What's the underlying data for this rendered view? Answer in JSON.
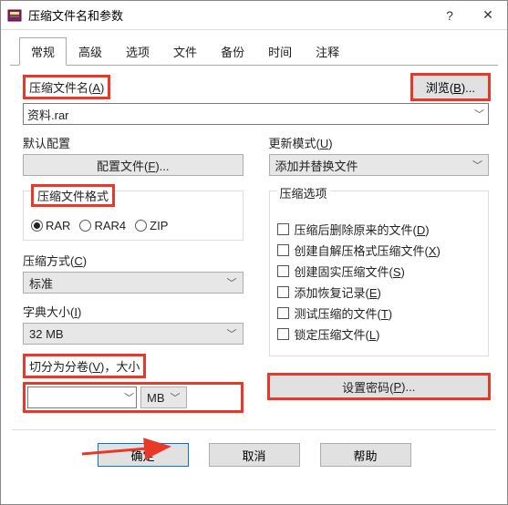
{
  "window": {
    "title": "压缩文件名和参数"
  },
  "tabs": {
    "items": [
      {
        "label": "常规"
      },
      {
        "label": "高级"
      },
      {
        "label": "选项"
      },
      {
        "label": "文件"
      },
      {
        "label": "备份"
      },
      {
        "label": "时间"
      },
      {
        "label": "注释"
      }
    ],
    "active_index": 0
  },
  "archive_name": {
    "label": "压缩文件名(",
    "accel": "A",
    "label_close": ")",
    "value": "资料.rar",
    "browse": "浏览(",
    "browse_accel": "B",
    "browse_close": ")..."
  },
  "default_profile": {
    "label": "默认配置",
    "button": "配置文件(",
    "accel": "F",
    "close": ")..."
  },
  "update_mode": {
    "label": "更新模式(",
    "accel": "U",
    "close": ")",
    "value": "添加并替换文件"
  },
  "format": {
    "label": "压缩文件格式",
    "options": [
      {
        "label": "RAR",
        "selected": true
      },
      {
        "label": "RAR4",
        "selected": false
      },
      {
        "label": "ZIP",
        "selected": false
      }
    ]
  },
  "method": {
    "label": "压缩方式(",
    "accel": "C",
    "close": ")",
    "value": "标准"
  },
  "dict": {
    "label": "字典大小(",
    "accel": "I",
    "close": ")",
    "value": "32 MB"
  },
  "split": {
    "label": "切分为分卷(",
    "accel": "V",
    "close": ")，大小",
    "value": "",
    "unit": "MB"
  },
  "options": {
    "label": "压缩选项",
    "items": [
      {
        "text": "压缩后删除原来的文件(",
        "a": "D",
        "close": ")"
      },
      {
        "text": "创建自解压格式压缩文件(",
        "a": "X",
        "close": ")"
      },
      {
        "text": "创建固实压缩文件(",
        "a": "S",
        "close": ")"
      },
      {
        "text": "添加恢复记录(",
        "a": "E",
        "close": ")"
      },
      {
        "text": "测试压缩的文件(",
        "a": "T",
        "close": ")"
      },
      {
        "text": "锁定压缩文件(",
        "a": "L",
        "close": ")"
      }
    ]
  },
  "password": {
    "label": "设置密码(",
    "accel": "P",
    "close": ")..."
  },
  "footer": {
    "ok": "确定",
    "cancel": "取消",
    "help": "帮助"
  }
}
